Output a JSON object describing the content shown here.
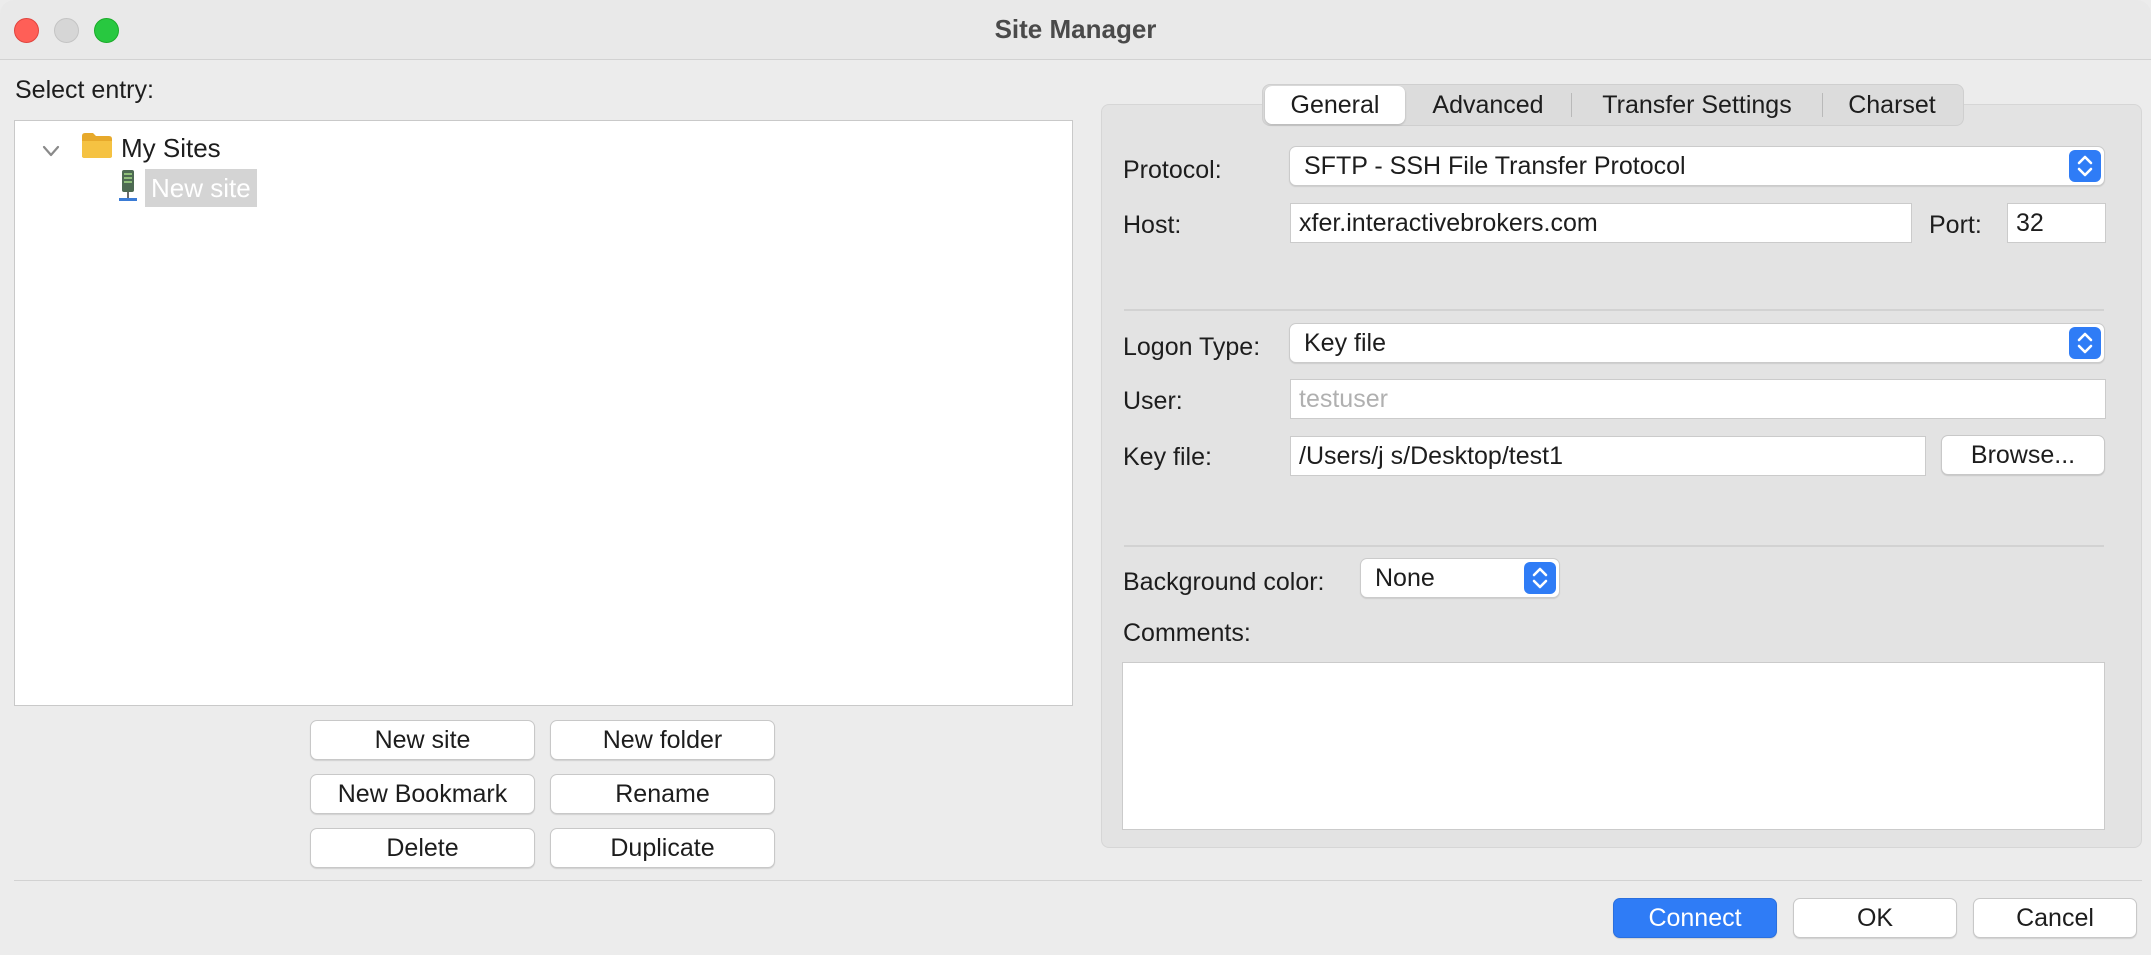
{
  "window": {
    "title": "Site Manager"
  },
  "left": {
    "select_entry_label": "Select entry:",
    "tree": {
      "root_label": "My Sites",
      "selected_item_label": "New site"
    },
    "buttons": {
      "new_site": "New site",
      "new_folder": "New folder",
      "new_bookmark": "New Bookmark",
      "rename": "Rename",
      "delete": "Delete",
      "duplicate": "Duplicate"
    }
  },
  "tabs": {
    "general": "General",
    "advanced": "Advanced",
    "transfer_settings": "Transfer Settings",
    "charset": "Charset",
    "active": "General"
  },
  "general": {
    "protocol_label": "Protocol:",
    "protocol_value": "SFTP - SSH File Transfer Protocol",
    "host_label": "Host:",
    "host_value": "xfer.interactivebrokers.com",
    "port_label": "Port:",
    "port_value": "32",
    "logon_type_label": "Logon Type:",
    "logon_type_value": "Key file",
    "user_label": "User:",
    "user_value": "testuser",
    "key_file_label": "Key file:",
    "key_file_value": "/Users/j  s/Desktop/test1",
    "browse_label": "Browse...",
    "background_color_label": "Background color:",
    "background_color_value": "None",
    "comments_label": "Comments:",
    "comments_value": ""
  },
  "footer": {
    "connect": "Connect",
    "ok": "OK",
    "cancel": "Cancel"
  },
  "colors": {
    "accent": "#2f7cf6",
    "close": "#ff5f57",
    "maximize": "#28c840",
    "folder": "#f5c242"
  }
}
